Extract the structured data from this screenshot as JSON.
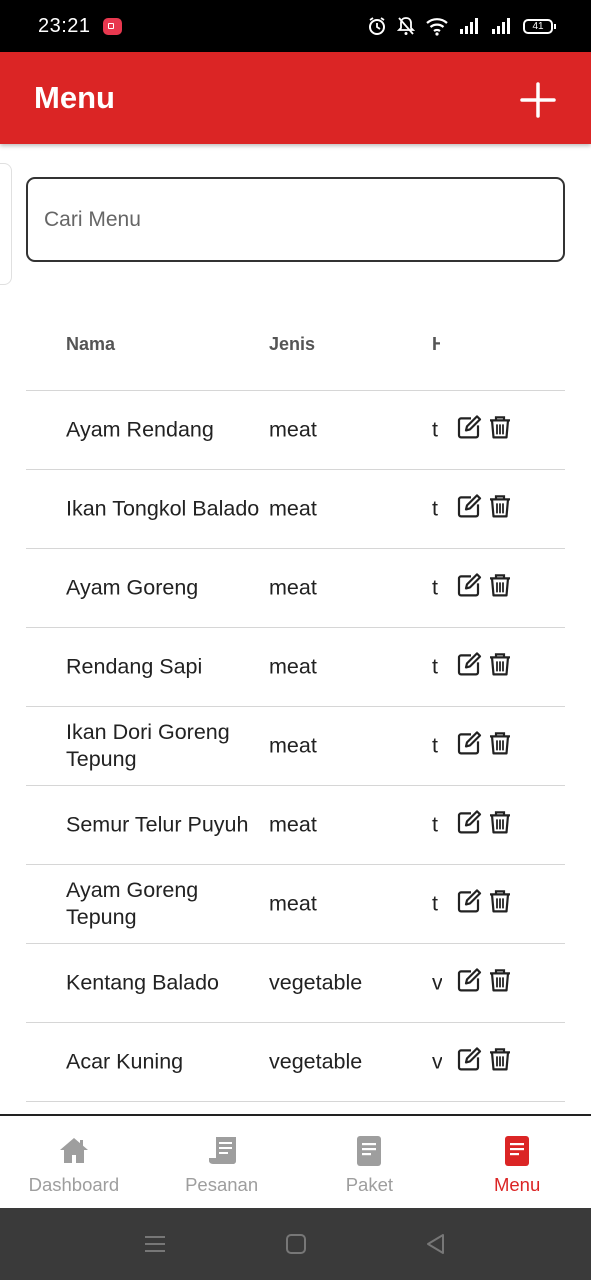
{
  "status_bar": {
    "time": "23:21",
    "battery": "41"
  },
  "app_bar": {
    "title": "Menu"
  },
  "search": {
    "placeholder": "Cari Menu"
  },
  "table": {
    "headers": {
      "name": "Nama",
      "type": "Jenis",
      "extra": "H"
    },
    "rows": [
      {
        "name": "Ayam Rendang",
        "type": "meat",
        "extra": "t"
      },
      {
        "name": "Ikan Tongkol Balado",
        "type": "meat",
        "extra": "t"
      },
      {
        "name": "Ayam Goreng",
        "type": "meat",
        "extra": "t"
      },
      {
        "name": "Rendang Sapi",
        "type": "meat",
        "extra": "t"
      },
      {
        "name": "Ikan Dori Goreng Tepung",
        "type": "meat",
        "extra": "t"
      },
      {
        "name": "Semur Telur Puyuh",
        "type": "meat",
        "extra": "t"
      },
      {
        "name": "Ayam Goreng Tepung",
        "type": "meat",
        "extra": "t"
      },
      {
        "name": "Kentang Balado",
        "type": "vegetable",
        "extra": "v"
      },
      {
        "name": "Acar Kuning",
        "type": "vegetable",
        "extra": "v"
      }
    ]
  },
  "bottom_nav": {
    "items": [
      {
        "label": "Dashboard",
        "icon": "home-icon"
      },
      {
        "label": "Pesanan",
        "icon": "receipt-icon"
      },
      {
        "label": "Paket",
        "icon": "document-icon"
      },
      {
        "label": "Menu",
        "icon": "menu-book-icon"
      }
    ],
    "active": "Menu"
  },
  "colors": {
    "primary": "#db2525",
    "inactive": "#9e9e9e"
  }
}
